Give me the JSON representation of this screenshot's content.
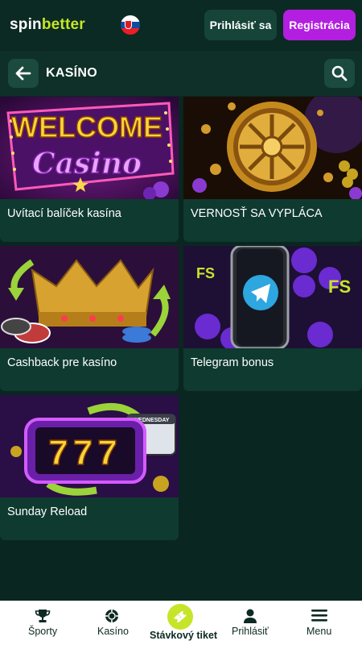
{
  "header": {
    "logo_part1": "spin",
    "logo_part2": "better",
    "flag_icon": "slovakia-flag-icon",
    "login_label": "Prihlásiť sa",
    "register_label": "Registrácia"
  },
  "subheader": {
    "title": "KASÍNO",
    "back_icon": "arrow-left-icon",
    "search_icon": "search-icon"
  },
  "promotions": [
    {
      "label": "Uvítací balíček kasína",
      "art_text_1": "WELCOME",
      "art_text_2": "Casino"
    },
    {
      "label": "VERNOSŤ SA VYPLÁCA"
    },
    {
      "label": "Cashback pre kasíno"
    },
    {
      "label": "Telegram bonus",
      "art_text_1": "FS",
      "art_text_2": "FS"
    },
    {
      "label": "Sunday Reload",
      "art_text_1": "777",
      "art_text_2": "WEDNESDAY"
    }
  ],
  "bottom_nav": {
    "items": [
      {
        "label": "Športy",
        "icon": "trophy-icon"
      },
      {
        "label": "Kasíno",
        "icon": "casino-chip-icon"
      },
      {
        "label": "Stávkový tiket",
        "icon": "ticket-icon"
      },
      {
        "label": "Prihlásiť",
        "icon": "user-icon"
      },
      {
        "label": "Menu",
        "icon": "hamburger-menu-icon"
      }
    ]
  },
  "colors": {
    "background": "#0a2620",
    "card": "#0f3a2f",
    "accent_green": "#c6e52a",
    "accent_purple": "#b31ee0"
  }
}
